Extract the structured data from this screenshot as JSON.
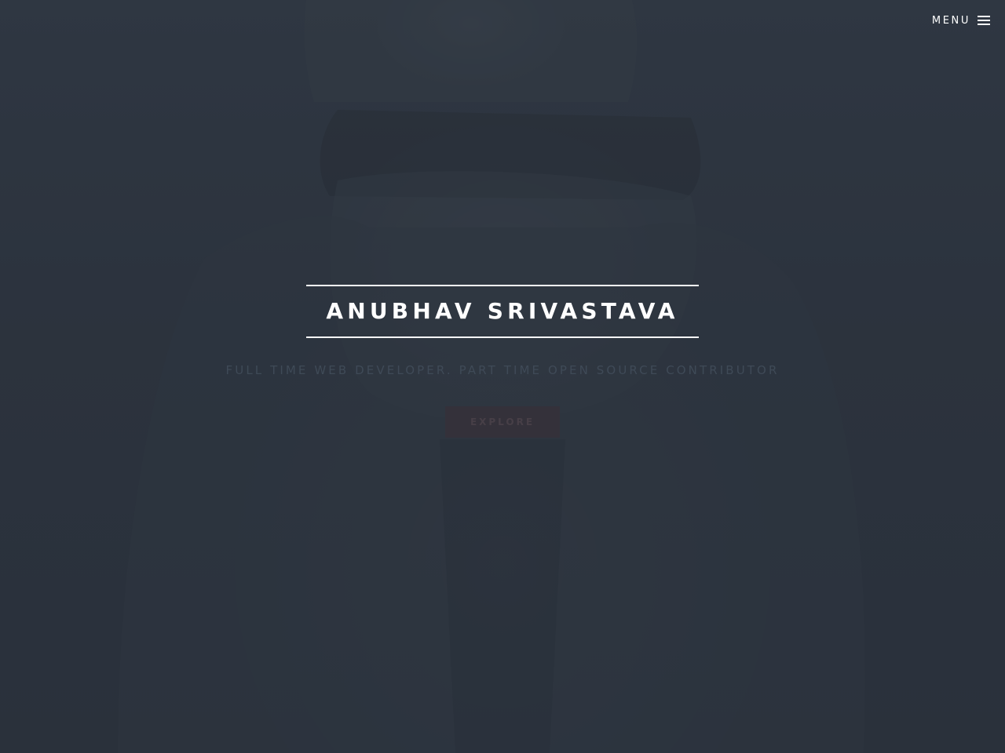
{
  "header": {
    "menu_label": "MENU",
    "menu_icon": "hamburger-menu-icon"
  },
  "hero": {
    "title": "ANUBHAV SRIVASTAVA",
    "subtitle": "FULL TIME WEB DEVELOPER. PART TIME OPEN SOURCE CONTRIBUTOR",
    "button_label": "EXPLORE"
  },
  "colors": {
    "background": "#2f3741",
    "title": "#ffffff",
    "subtitle": "#3f4a57",
    "button_bg": "#34313a",
    "button_text": "#473f47"
  }
}
